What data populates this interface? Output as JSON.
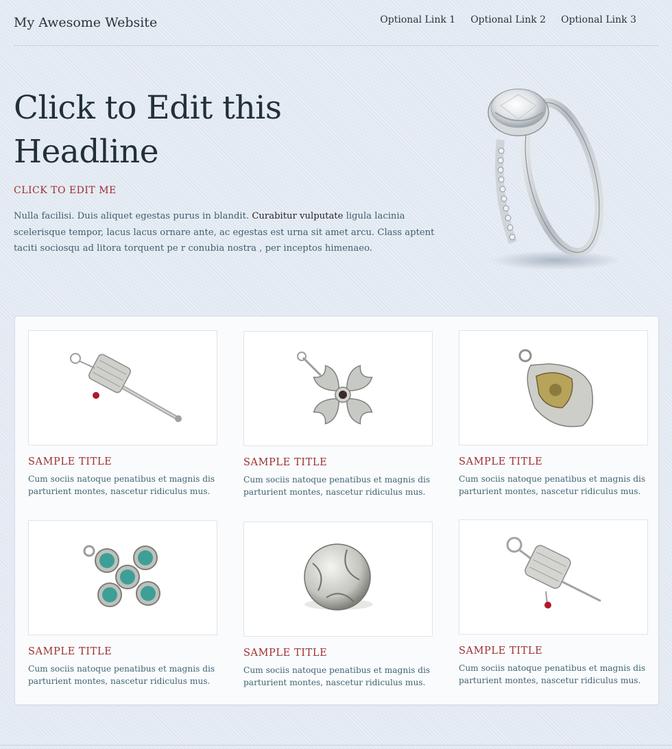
{
  "header": {
    "site_title": "My Awesome Website",
    "nav": [
      "Optional Link 1",
      "Optional Link 2",
      "Optional Link 3"
    ]
  },
  "hero": {
    "headline": "Click to Edit this Headline",
    "subheading": "CLICK TO EDIT ME",
    "body_part1": "Nulla facilisi. Duis aliquet egestas purus in blandit.  ",
    "body_highlight": "Curabitur vulputate",
    "body_part2": "  ligula lacinia scelerisque tempor, lacus lacus ornare ante, ac egestas est urna sit amet arcu. Class aptent taciti sociosqu ad litora torquent pe r conubia nostra , per inceptos himenaeo."
  },
  "products": [
    {
      "title": "SAMPLE TITLE",
      "description": "Cum sociis natoque penatibus et magnis dis parturient montes, nascetur ridiculus mus.",
      "image": "prayer-wheel-pendant"
    },
    {
      "title": "SAMPLE TITLE",
      "description": "Cum sociis natoque penatibus et magnis dis parturient montes, nascetur ridiculus mus.",
      "image": "dorje-cross-pendant"
    },
    {
      "title": "SAMPLE TITLE",
      "description": "Cum sociis natoque penatibus et magnis dis parturient montes, nascetur ridiculus mus.",
      "image": "brass-amulet-pendant"
    },
    {
      "title": "SAMPLE TITLE",
      "description": "Cum sociis natoque penatibus et magnis dis parturient montes, nascetur ridiculus mus.",
      "image": "turquoise-pendant"
    },
    {
      "title": "SAMPLE TITLE",
      "description": "Cum sociis natoque penatibus et magnis dis parturient montes, nascetur ridiculus mus.",
      "image": "silver-bead"
    },
    {
      "title": "SAMPLE TITLE",
      "description": "Cum sociis natoque penatibus et magnis dis parturient montes, nascetur ridiculus mus.",
      "image": "prayer-wheel-charm"
    }
  ],
  "colors": {
    "background": "#e3eaf3",
    "accent_red": "#9b2f2f",
    "body_text": "#3e5f6c",
    "headline": "#223038"
  }
}
